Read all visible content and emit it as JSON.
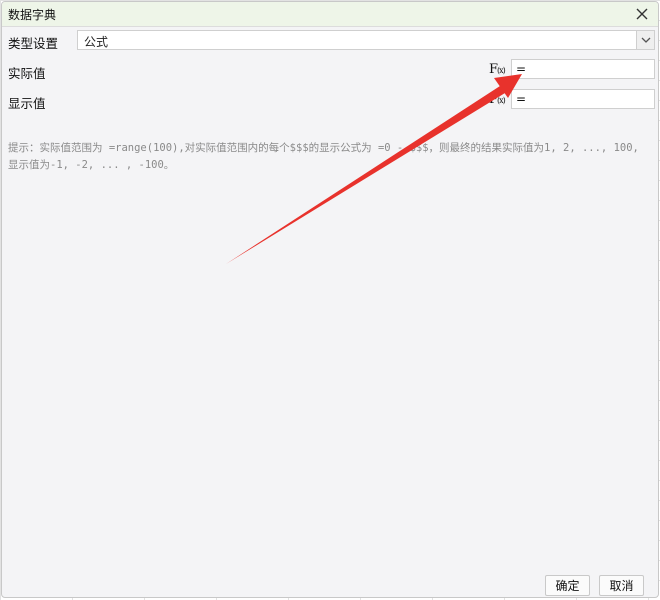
{
  "dialog": {
    "title": "数据字典",
    "close_icon": "close-icon"
  },
  "type_setting": {
    "label": "类型设置",
    "selected_value": "公式"
  },
  "actual_value": {
    "label": "实际值",
    "fx_label": "F",
    "fx_sub": "(x)",
    "value": "="
  },
  "display_value": {
    "label": "显示值",
    "fx_label": "F",
    "fx_sub": "(x)",
    "value": "="
  },
  "hint": {
    "text": "提示：实际值范围为 =range(100),对实际值范围内的每个$$$的显示公式为 =0 - $$$，则最终的结果实际值为1, 2, ..., 100,显示值为-1, -2, ... , -100。"
  },
  "footer": {
    "ok_label": "确定",
    "cancel_label": "取消"
  },
  "colors": {
    "annotation_arrow": "#e8322c",
    "titlebar_bg": "#eef5e8",
    "dialog_bg": "#f4f4f6"
  }
}
